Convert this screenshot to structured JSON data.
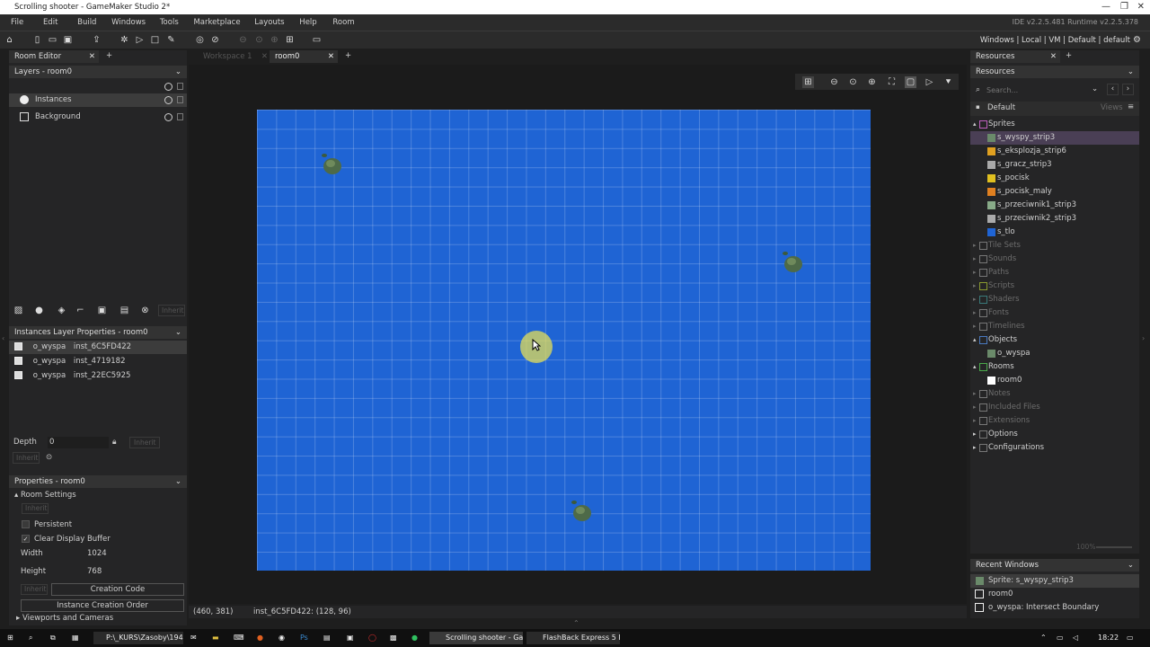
{
  "window": {
    "title": "Scrolling shooter - GameMaker Studio 2*",
    "controls": [
      "—",
      "❐",
      "✕"
    ]
  },
  "menu": {
    "items": [
      "File",
      "Edit",
      "Build",
      "Windows",
      "Tools",
      "Marketplace",
      "Layouts",
      "Help",
      "Room"
    ],
    "ide_version": "IDE v2.2.5.481  Runtime v2.2.5.378"
  },
  "toolbar": {
    "target": "Windows | Local | VM | Default | default"
  },
  "left": {
    "tab": "Room Editor",
    "add": "+",
    "layers_header": "Layers - room0",
    "layers": [
      {
        "label": "Instances"
      },
      {
        "label": "Background"
      }
    ],
    "inherit_label": "Inherit",
    "instances_header": "Instances Layer Properties - room0",
    "instances": [
      {
        "object": "o_wyspa",
        "name": "inst_6C5FD422"
      },
      {
        "object": "o_wyspa",
        "name": "inst_4719182"
      },
      {
        "object": "o_wyspa",
        "name": "inst_22EC5925"
      }
    ],
    "depth_label": "Depth",
    "depth_value": "0",
    "properties_header": "Properties - room0",
    "room_settings": "Room Settings",
    "persistent": "Persistent",
    "clear_display": "Clear Display Buffer",
    "width_label": "Width",
    "width_value": "1024",
    "height_label": "Height",
    "height_value": "768",
    "creation_code": "Creation Code",
    "instance_order": "Instance Creation Order",
    "viewports": "Viewports and Cameras"
  },
  "center": {
    "tabs": [
      {
        "label": "Workspace 1"
      },
      {
        "label": "room0"
      }
    ],
    "status_coords": "(460, 381)",
    "status_instance": "inst_6C5FD422: (128, 96)"
  },
  "right": {
    "tab": "Resources",
    "header": "Resources",
    "search_placeholder": "Search...",
    "group": "Default",
    "views": "Views",
    "items": [
      {
        "label": "Sprites",
        "level": 0,
        "open": true,
        "color": "#c060c0"
      },
      {
        "label": "s_wyspy_strip3",
        "level": 1,
        "selected": true,
        "color": "#6a8a6a"
      },
      {
        "label": "s_eksplozja_strip6",
        "level": 1,
        "color": "#e0a020"
      },
      {
        "label": "s_gracz_strip3",
        "level": 1,
        "color": "#aaaaaa"
      },
      {
        "label": "s_pocisk",
        "level": 1,
        "color": "#e0c020"
      },
      {
        "label": "s_pocisk_maly",
        "level": 1,
        "color": "#e08020"
      },
      {
        "label": "s_przeciwnik1_strip3",
        "level": 1,
        "color": "#88aa88"
      },
      {
        "label": "s_przeciwnik2_strip3",
        "level": 1,
        "color": "#aaaaaa"
      },
      {
        "label": "s_tlo",
        "level": 1,
        "color": "#1f64d4"
      },
      {
        "label": "Tile Sets",
        "level": 0,
        "dim": true,
        "color": "#777"
      },
      {
        "label": "Sounds",
        "level": 0,
        "dim": true,
        "color": "#777"
      },
      {
        "label": "Paths",
        "level": 0,
        "dim": true,
        "color": "#777"
      },
      {
        "label": "Scripts",
        "level": 0,
        "dim": true,
        "color": "#8a9a30"
      },
      {
        "label": "Shaders",
        "level": 0,
        "dim": true,
        "color": "#3a7a7a"
      },
      {
        "label": "Fonts",
        "level": 0,
        "dim": true,
        "color": "#777"
      },
      {
        "label": "Timelines",
        "level": 0,
        "dim": true,
        "color": "#777"
      },
      {
        "label": "Objects",
        "level": 0,
        "open": true,
        "color": "#4a7ac0"
      },
      {
        "label": "o_wyspa",
        "level": 1,
        "color": "#6a8a6a"
      },
      {
        "label": "Rooms",
        "level": 0,
        "open": true,
        "color": "#4aaa4a"
      },
      {
        "label": "room0",
        "level": 1,
        "color": "#ffffff"
      },
      {
        "label": "Notes",
        "level": 0,
        "dim": true,
        "color": "#777"
      },
      {
        "label": "Included Files",
        "level": 0,
        "dim": true,
        "color": "#777"
      },
      {
        "label": "Extensions",
        "level": 0,
        "dim": true,
        "color": "#777"
      },
      {
        "label": "Options",
        "level": 0,
        "closed": true,
        "color": "#777"
      },
      {
        "label": "Configurations",
        "level": 0,
        "closed": true,
        "color": "#777"
      }
    ],
    "zoom": "100%",
    "recent_header": "Recent Windows",
    "recent": [
      "Sprite: s_wyspy_strip3",
      "room0",
      "o_wyspa: Intersect Boundary"
    ]
  },
  "taskbar": {
    "apps": [
      {
        "label": "P:\\_KURS\\Zasoby\\1945"
      },
      {
        "label": "Scrolling shooter - Ga..."
      },
      {
        "label": "FlashBack Express 5 R..."
      }
    ],
    "time": "18:22"
  }
}
